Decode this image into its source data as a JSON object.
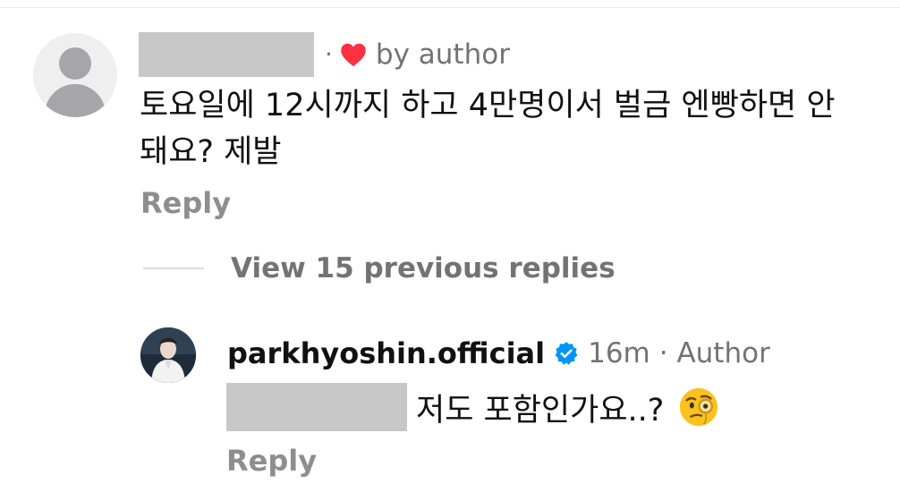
{
  "comment": {
    "badge_separator": "·",
    "liked_by_label": "by author",
    "text": "토요일에 12시까지 하고 4만명이서 벌금 엔빵하면 안돼요? 제발",
    "reply_label": "Reply"
  },
  "thread": {
    "view_replies_label": "View 15 previous replies"
  },
  "reply": {
    "username": "parkhyoshin.official",
    "time": "16m",
    "author_label": "· Author",
    "text": "저도 포함인가요..?",
    "reply_label": "Reply"
  },
  "icons": {
    "heart": "heart-icon",
    "verified": "verified-badge-icon",
    "emoji": "face-with-monocle-icon",
    "default_avatar": "default-avatar-icon"
  },
  "colors": {
    "heart": "#ff3040",
    "verified": "#0095f6",
    "muted_text": "#737373",
    "redaction": "#c7c7c7"
  }
}
